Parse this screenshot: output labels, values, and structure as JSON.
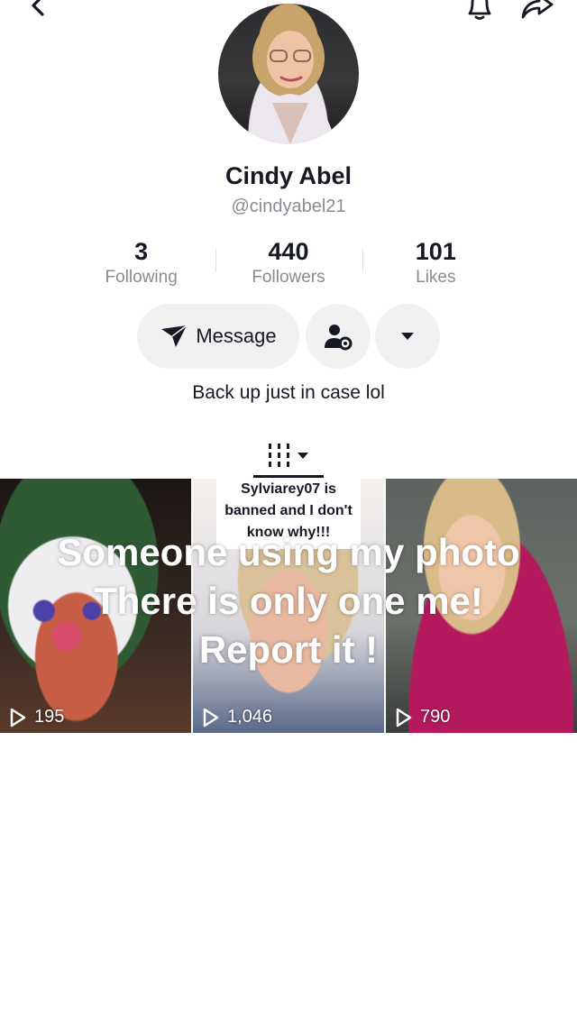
{
  "profile": {
    "name": "Cindy Abel",
    "handle": "@cindyabel21",
    "bio": "Back up just in case lol"
  },
  "stats": [
    {
      "value": "3",
      "label": "Following"
    },
    {
      "value": "440",
      "label": "Followers"
    },
    {
      "value": "101",
      "label": "Likes"
    }
  ],
  "actions": {
    "message_label": "Message"
  },
  "videos": [
    {
      "views": "195"
    },
    {
      "views": "1,046",
      "caption": "Sylviarey07 is banned and I don't know why!!!"
    },
    {
      "views": "790"
    }
  ],
  "overlay_text": "Someone using my photo\nThere is only one me!\nReport it !",
  "icons": {
    "back": "chevron-left-icon",
    "bell": "bell-icon",
    "share": "share-arrow-icon",
    "send": "send-icon",
    "friends": "person-gear-icon",
    "more": "caret-down-icon",
    "grid": "grid-bars-icon",
    "play": "play-icon"
  }
}
